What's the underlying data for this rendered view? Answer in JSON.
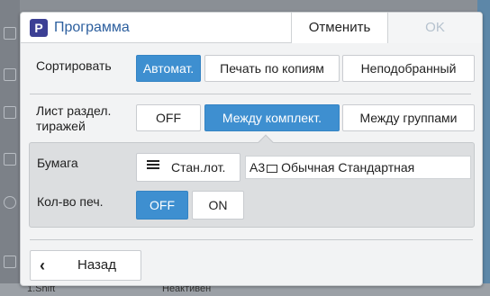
{
  "dialog": {
    "icon_letter": "P",
    "title": "Программа",
    "cancel_label": "Отменить",
    "ok_label": "OK"
  },
  "sort": {
    "label": "Сортировать",
    "options": [
      "Автомат.",
      "Печать по копиям",
      "Неподобранный"
    ],
    "selected": "Автомат."
  },
  "separator": {
    "label_line1": "Лист раздел.",
    "label_line2": "тиражей",
    "options": [
      "OFF",
      "Между комплект.",
      "Между группами"
    ],
    "selected": "Между комплект."
  },
  "paper": {
    "label": "Бумага",
    "tray_label": "Стан.лот.",
    "size": "A3",
    "description": "Обычная Стандартная"
  },
  "copies": {
    "label": "Кол-во печ.",
    "options": [
      "OFF",
      "ON"
    ],
    "selected": "OFF"
  },
  "footer": {
    "back_label": "Назад"
  },
  "background": {
    "bottom_left_text": "1.Shift",
    "bottom_mid_text": "Неактивен"
  },
  "colors": {
    "accent": "#3e8fd0",
    "title_text": "#2c5f9e",
    "icon_bg": "#3c3f94"
  }
}
